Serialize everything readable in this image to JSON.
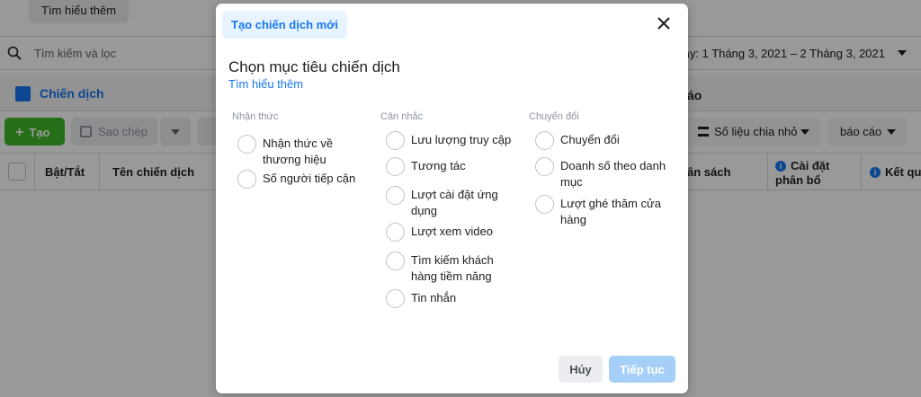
{
  "background": {
    "top_button": "Tìm hiểu thêm",
    "search": {
      "placeholder": "Tìm kiếm và lọc"
    },
    "date_range": "g này: 1 Tháng 3, 2021 – 2 Tháng 3, 2021",
    "tab_label": "Chiến dịch",
    "tab_right": "áo",
    "toolbar": {
      "create_label": "Tạo",
      "copy_label": "Sao chép",
      "breakdown_label": "Số liệu chia nhỏ",
      "report_label": "báo cáo"
    },
    "table": {
      "headers": [
        "Bật/Tắt",
        "Tên chiến dịch",
        "ân sách",
        "Cài đặt phân bổ",
        "Kết qu"
      ]
    }
  },
  "modal": {
    "tab": "Tạo chiến dịch mới",
    "title": "Chọn mục tiêu chiến dịch",
    "learn_more": "Tìm hiểu thêm",
    "groups": [
      {
        "label": "Nhận thức",
        "options": [
          "Nhận thức về thương hiệu",
          "Số người tiếp cận"
        ]
      },
      {
        "label": "Cân nhắc",
        "options": [
          "Lưu lượng truy cập",
          "Tương tác",
          "Lượt cài đặt ứng dụng",
          "Lượt xem video",
          "Tìm kiếm khách hàng tiềm năng",
          "Tin nhắn"
        ]
      },
      {
        "label": "Chuyển đổi",
        "options": [
          "Chuyển đổi",
          "Doanh số theo danh mục",
          "Lượt ghé thăm cửa hàng"
        ]
      }
    ],
    "cancel": "Hủy",
    "continue": "Tiếp tục"
  },
  "colors": {
    "accent": "#1877f2",
    "create_green": "#42b72a",
    "continue_disabled": "#a6cff7",
    "overlay": "rgba(0,0,0,0.4)"
  }
}
